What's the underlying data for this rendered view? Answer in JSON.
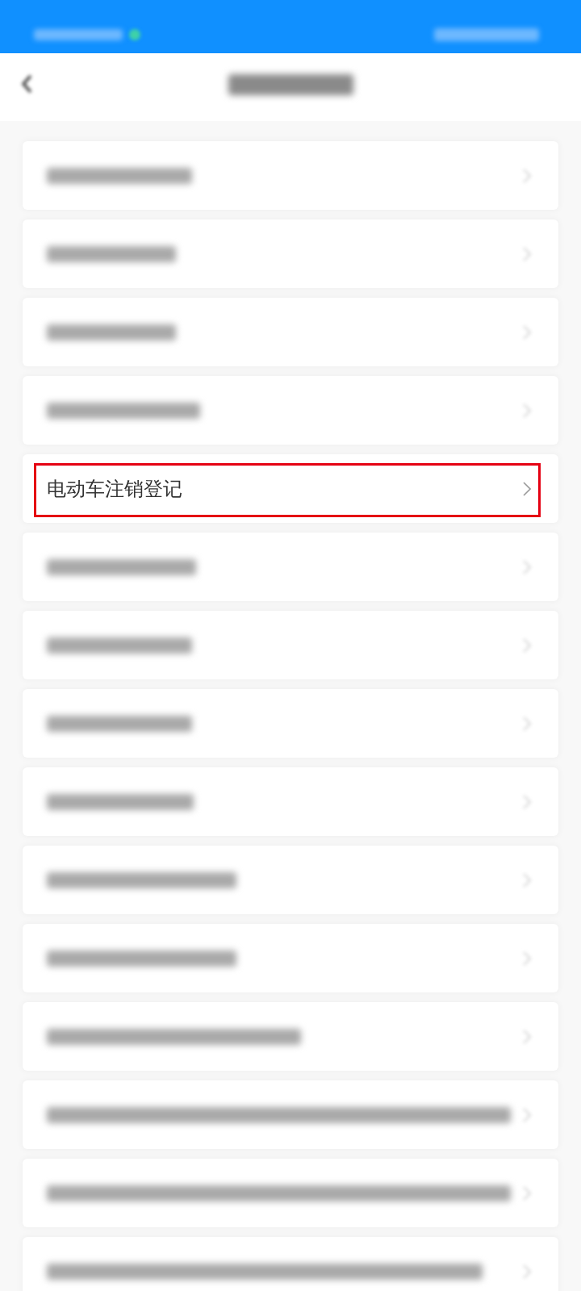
{
  "status_bar": {
    "kind": "blurred"
  },
  "header": {
    "title": {
      "kind": "blurred"
    }
  },
  "items": [
    {
      "kind": "blurred",
      "highlighted": false
    },
    {
      "kind": "blurred",
      "highlighted": false
    },
    {
      "kind": "blurred",
      "highlighted": false
    },
    {
      "kind": "blurred",
      "highlighted": false
    },
    {
      "kind": "text",
      "label": "电动车注销登记",
      "highlighted": true
    },
    {
      "kind": "blurred",
      "highlighted": false
    },
    {
      "kind": "blurred",
      "highlighted": false
    },
    {
      "kind": "blurred",
      "highlighted": false
    },
    {
      "kind": "blurred",
      "highlighted": false
    },
    {
      "kind": "blurred",
      "highlighted": false
    },
    {
      "kind": "blurred",
      "highlighted": false
    },
    {
      "kind": "blurred",
      "highlighted": false
    },
    {
      "kind": "blurred",
      "highlighted": false
    },
    {
      "kind": "blurred",
      "highlighted": false
    },
    {
      "kind": "blurred",
      "highlighted": false
    }
  ]
}
